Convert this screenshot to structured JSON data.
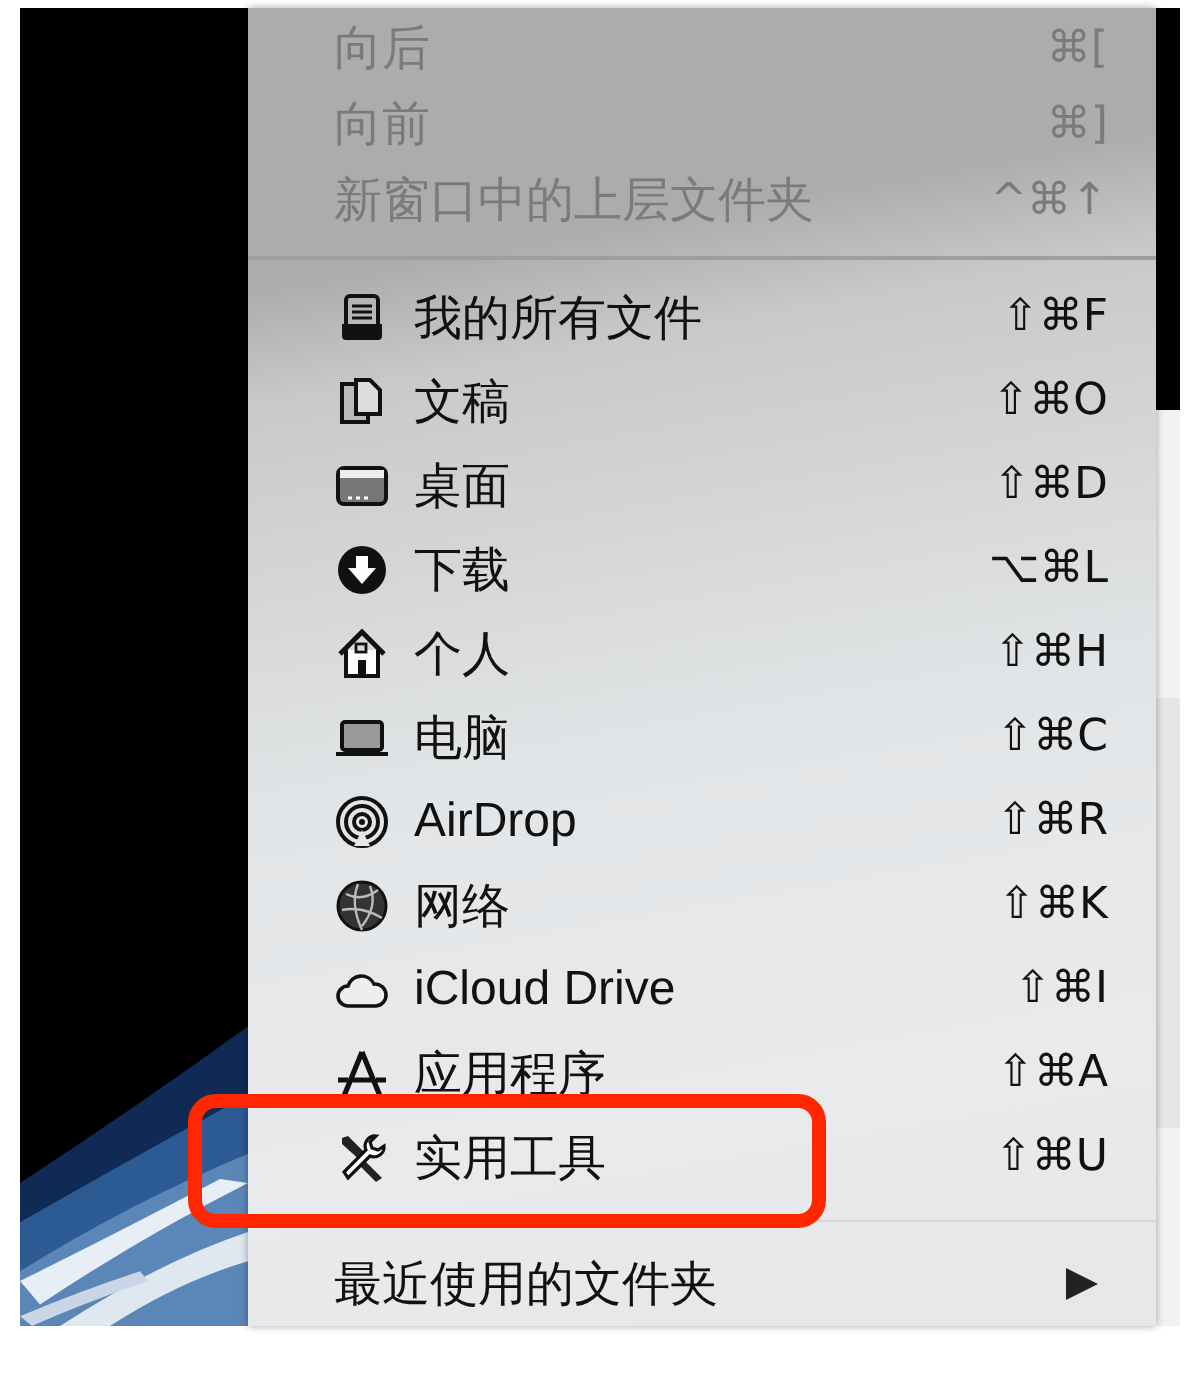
{
  "menu": {
    "sections": [
      {
        "items": [
          {
            "label": "向后",
            "shortcut": "⌘[",
            "disabled": true
          },
          {
            "label": "向前",
            "shortcut": "⌘]",
            "disabled": true
          },
          {
            "label": "新窗口中的上层文件夹",
            "shortcut": "^⌘↑",
            "disabled": true
          }
        ]
      },
      {
        "items": [
          {
            "kind": "recents",
            "label": "我的所有文件",
            "shortcut": "⇧⌘F",
            "disabled": false,
            "annotated": false
          },
          {
            "kind": "documents",
            "label": "文稿",
            "shortcut": "⇧⌘O",
            "disabled": false,
            "annotated": false
          },
          {
            "kind": "desktop",
            "label": "桌面",
            "shortcut": "⇧⌘D",
            "disabled": false,
            "annotated": false
          },
          {
            "kind": "downloads",
            "label": "下载",
            "shortcut": "⌥⌘L",
            "disabled": false,
            "annotated": false
          },
          {
            "kind": "home",
            "label": "个人",
            "shortcut": "⇧⌘H",
            "disabled": false,
            "annotated": false
          },
          {
            "kind": "computer",
            "label": "电脑",
            "shortcut": "⇧⌘C",
            "disabled": false,
            "annotated": false
          },
          {
            "kind": "airdrop",
            "label": "AirDrop",
            "shortcut": "⇧⌘R",
            "disabled": false,
            "annotated": false
          },
          {
            "kind": "network",
            "label": "网络",
            "shortcut": "⇧⌘K",
            "disabled": false,
            "annotated": false
          },
          {
            "kind": "icloud",
            "label": "iCloud Drive",
            "shortcut": "⇧⌘I",
            "disabled": false,
            "annotated": false
          },
          {
            "kind": "applications",
            "label": "应用程序",
            "shortcut": "⇧⌘A",
            "disabled": false,
            "annotated": false
          },
          {
            "kind": "utilities",
            "label": "实用工具",
            "shortcut": "⇧⌘U",
            "disabled": false,
            "annotated": true
          }
        ]
      },
      {
        "items": [
          {
            "label": "最近使用的文件夹",
            "disabled": false,
            "submenu": true
          }
        ]
      }
    ]
  }
}
